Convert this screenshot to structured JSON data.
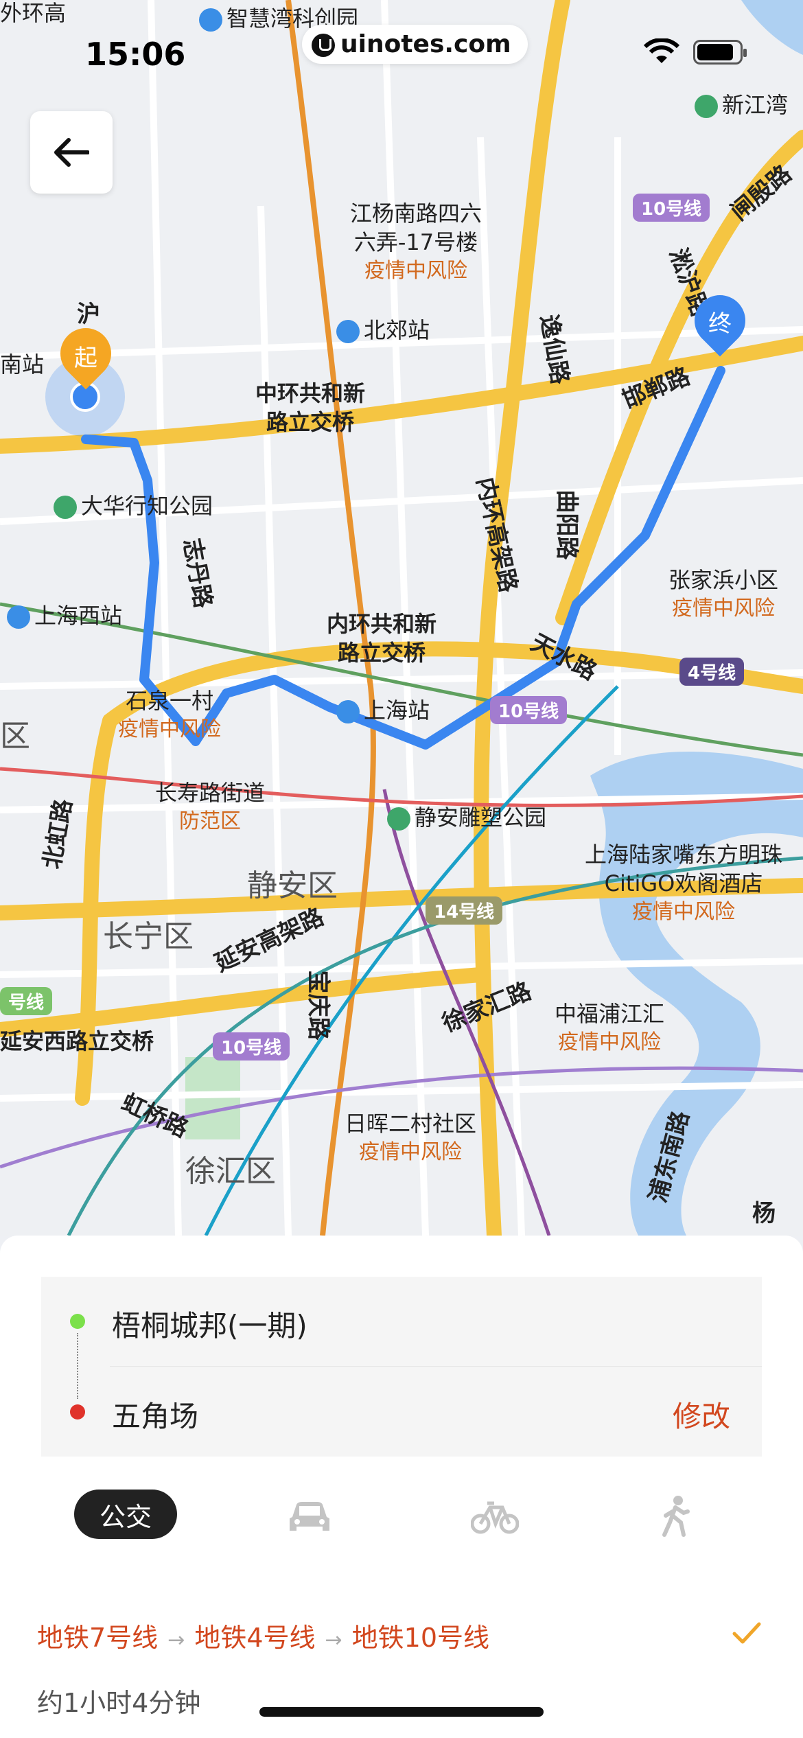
{
  "status": {
    "time": "15:06",
    "watermark": "uinotes.com"
  },
  "map": {
    "places": {
      "zhihui": "智慧湾科创园",
      "xinjiangwan": "新江湾",
      "jiangyang": [
        "江杨南路四六",
        "六弄-17号楼"
      ],
      "jiangyang_risk": "疫情中风险",
      "beijiao": "北郊站",
      "zhonghuan": [
        "中环共和新",
        "路立交桥"
      ],
      "dahua": "大华行知公园",
      "shanghaixi": "上海西站",
      "neihuan": [
        "内环共和新",
        "路立交桥"
      ],
      "shanghaizhan": "上海站",
      "shiquan": "石泉一村",
      "shiquan_risk": "疫情中风险",
      "changshou": "长寿路街道",
      "changshou_risk": "防范区",
      "jingandiaosu": "静安雕塑公园",
      "zhangjiabang": "张家浜小区",
      "zhangjiabang_risk": "疫情中风险",
      "lujiazui": [
        "上海陆家嘴东方明珠",
        "CitiGO欢阁酒店"
      ],
      "lujiazui_risk": "疫情中风险",
      "zhongfu": "中福浦江汇",
      "zhongfu_risk": "疫情中风险",
      "rihui": "日晖二村社区",
      "rihui_risk": "疫情中风险",
      "jingan": "静安区",
      "changning": "长宁区",
      "xuhui": "徐汇区",
      "yananxi": "延安西路立交桥",
      "waihuan": "外环高",
      "nanzhan": "南站",
      "zuoqu": "区",
      "hao": "号线"
    },
    "roads": {
      "yixian": "逸仙路",
      "handan": "邯郸路",
      "zhadian": "闸殷路",
      "songhu": "淞沪路",
      "neihuan_gj": "内环高架路",
      "quyang": "曲阳路",
      "tianshui": "天水路",
      "zhidan": "志丹路",
      "beibei": "北虹路",
      "yanan": "延安高架路",
      "baoqing": "宝庆路",
      "xujiahui": "徐家汇路",
      "hongqiao": "虹桥路",
      "pudongnan": "浦东南路",
      "hu": "沪",
      "yang": "杨"
    },
    "badges": {
      "l10a": "10号线",
      "l10b": "10号线",
      "l10c": "10号线",
      "l4": "4号线",
      "l14": "14号线"
    },
    "markers": {
      "start": "起",
      "end": "终"
    }
  },
  "route": {
    "origin": "梧桐城邦(一期)",
    "destination": "五角场",
    "edit_label": "修改",
    "modes": {
      "bus": "公交"
    },
    "lines": [
      "地铁7号线",
      "地铁4号线",
      "地铁10号线"
    ],
    "duration": "约1小时4分钟"
  },
  "colors": {
    "route": "#3a86f0",
    "accent": "#d2471e",
    "origin_dot": "#7be04a",
    "dest_dot": "#e0322a"
  }
}
